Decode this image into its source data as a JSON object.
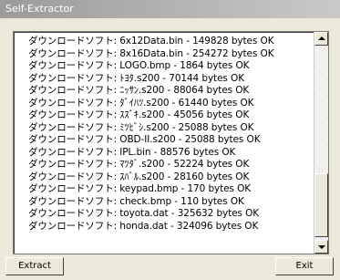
{
  "window": {
    "title": "Self-Extractor"
  },
  "log": {
    "lines": [
      "ダウンロードソフト: 6x12Data.bin - 149828 bytes OK",
      "ダウンロードソフト: 8x16Data.bin - 254272 bytes OK",
      "ダウンロードソフト: LOGO.bmp - 1864 bytes OK",
      "ダウンロードソフト: ﾄﾖﾀ.s200 - 70144 bytes OK",
      "ダウンロードソフト: ﾆｯｻﾝ.s200 - 88064 bytes OK",
      "ダウンロードソフト: ﾀﾞｲﾊﾂ.s200 - 61440 bytes OK",
      "ダウンロードソフト: ｽｽﾞｷ.s200 - 45056 bytes OK",
      "ダウンロードソフト: ﾐﾂﾋﾞｼ.s200 - 25088 bytes OK",
      "ダウンロードソフト: OBD-II.s200 - 25088 bytes OK",
      "ダウンロードソフト: IPL.bin - 88576 bytes OK",
      "ダウンロードソフト: ﾏﾂﾀﾞ.s200 - 52224 bytes OK",
      "ダウンロードソフト: ｽﾊﾞﾙ.s200 - 28160 bytes OK",
      "ダウンロードソフト: keypad.bmp - 170 bytes OK",
      "ダウンロードソフト: check.bmp - 110 bytes OK",
      "ダウンロードソフト: toyota.dat - 325632 bytes OK",
      "ダウンロードソフト: honda.dat - 324096 bytes OK"
    ]
  },
  "buttons": {
    "extract": "Extract",
    "exit": "Exit"
  }
}
